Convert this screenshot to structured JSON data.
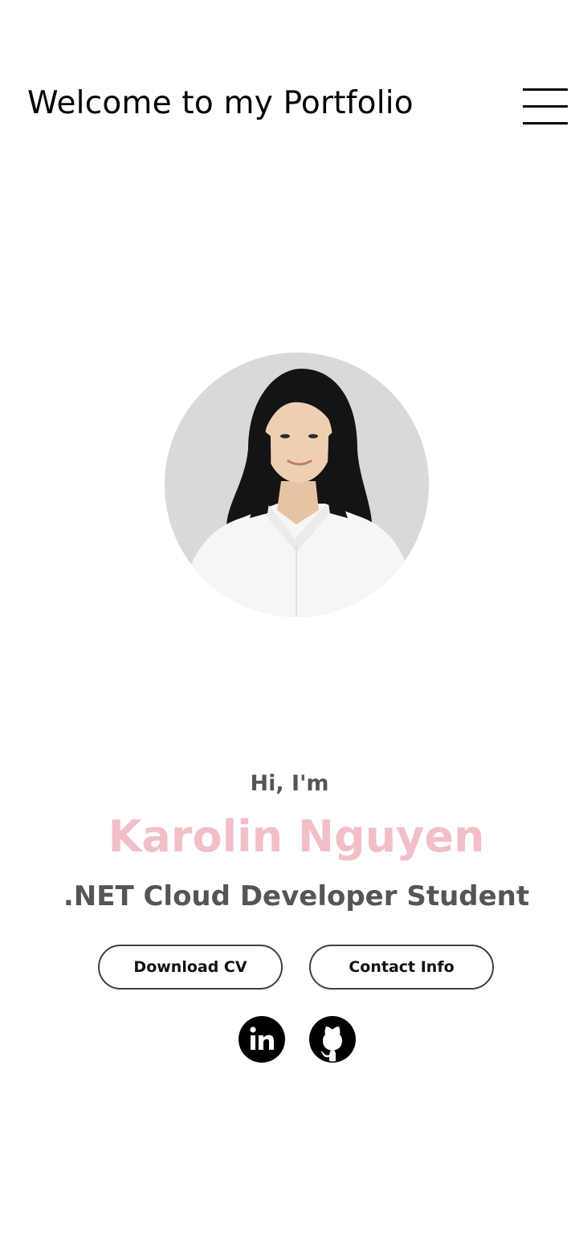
{
  "header": {
    "title": "Welcome to my Portfolio",
    "menu_icon": "hamburger-menu-icon"
  },
  "profile": {
    "photo_alt": "Karolin Nguyen",
    "greeting": "Hi, I'm",
    "name": "Karolin Nguyen",
    "role": ".NET Cloud Developer Student"
  },
  "buttons": {
    "download_cv": "Download CV",
    "contact_info": "Contact Info"
  },
  "social": {
    "linkedin_icon": "linkedin-icon",
    "linkedin_text": "in",
    "github_icon": "github-icon"
  },
  "colors": {
    "name_accent": "#f2bfc8",
    "text_gray": "#555555",
    "icon": "#000000"
  }
}
